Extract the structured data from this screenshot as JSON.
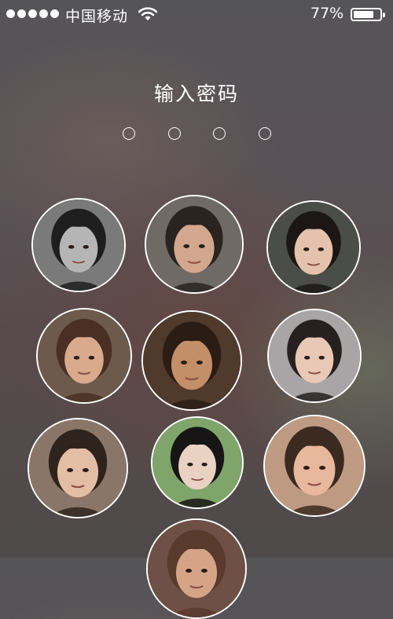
{
  "status_bar": {
    "carrier": "中国移动",
    "battery_percent": "77%",
    "battery_level": 0.77,
    "signal_bars": 5
  },
  "lock_screen": {
    "title": "输入密码",
    "passcode_length": 4,
    "entered_digits": 0
  },
  "keypad": {
    "keys": [
      {
        "photo": "monochrome-portrait",
        "bg": "#7a7a7a",
        "skin": "#b5b5b5",
        "hair": "#1e1e1e"
      },
      {
        "photo": "portrait",
        "bg": "#6f6a66",
        "skin": "#d2a78d",
        "hair": "#2a2320"
      },
      {
        "photo": "portrait",
        "bg": "#4a4d48",
        "skin": "#e4c2ab",
        "hair": "#1c1715"
      },
      {
        "photo": "portrait",
        "bg": "#6e5a4c",
        "skin": "#d9aa8c",
        "hair": "#4a3024"
      },
      {
        "photo": "portrait",
        "bg": "#503a2c",
        "skin": "#c38f68",
        "hair": "#2b1c14"
      },
      {
        "photo": "portrait",
        "bg": "#a9a5a6",
        "skin": "#e9c8b5",
        "hair": "#262020"
      },
      {
        "photo": "portrait",
        "bg": "#8a7668",
        "skin": "#e4bda5",
        "hair": "#2f241d"
      },
      {
        "photo": "portrait",
        "bg": "#7fa56a",
        "skin": "#ead2c3",
        "hair": "#171515"
      },
      {
        "photo": "portrait",
        "bg": "#bf9a82",
        "skin": "#e8b89c",
        "hair": "#3b2a20"
      },
      {
        "photo": "portrait-partial",
        "bg": "#6e5046",
        "skin": "#d5a487",
        "hair": "#5a3a2c"
      }
    ]
  }
}
